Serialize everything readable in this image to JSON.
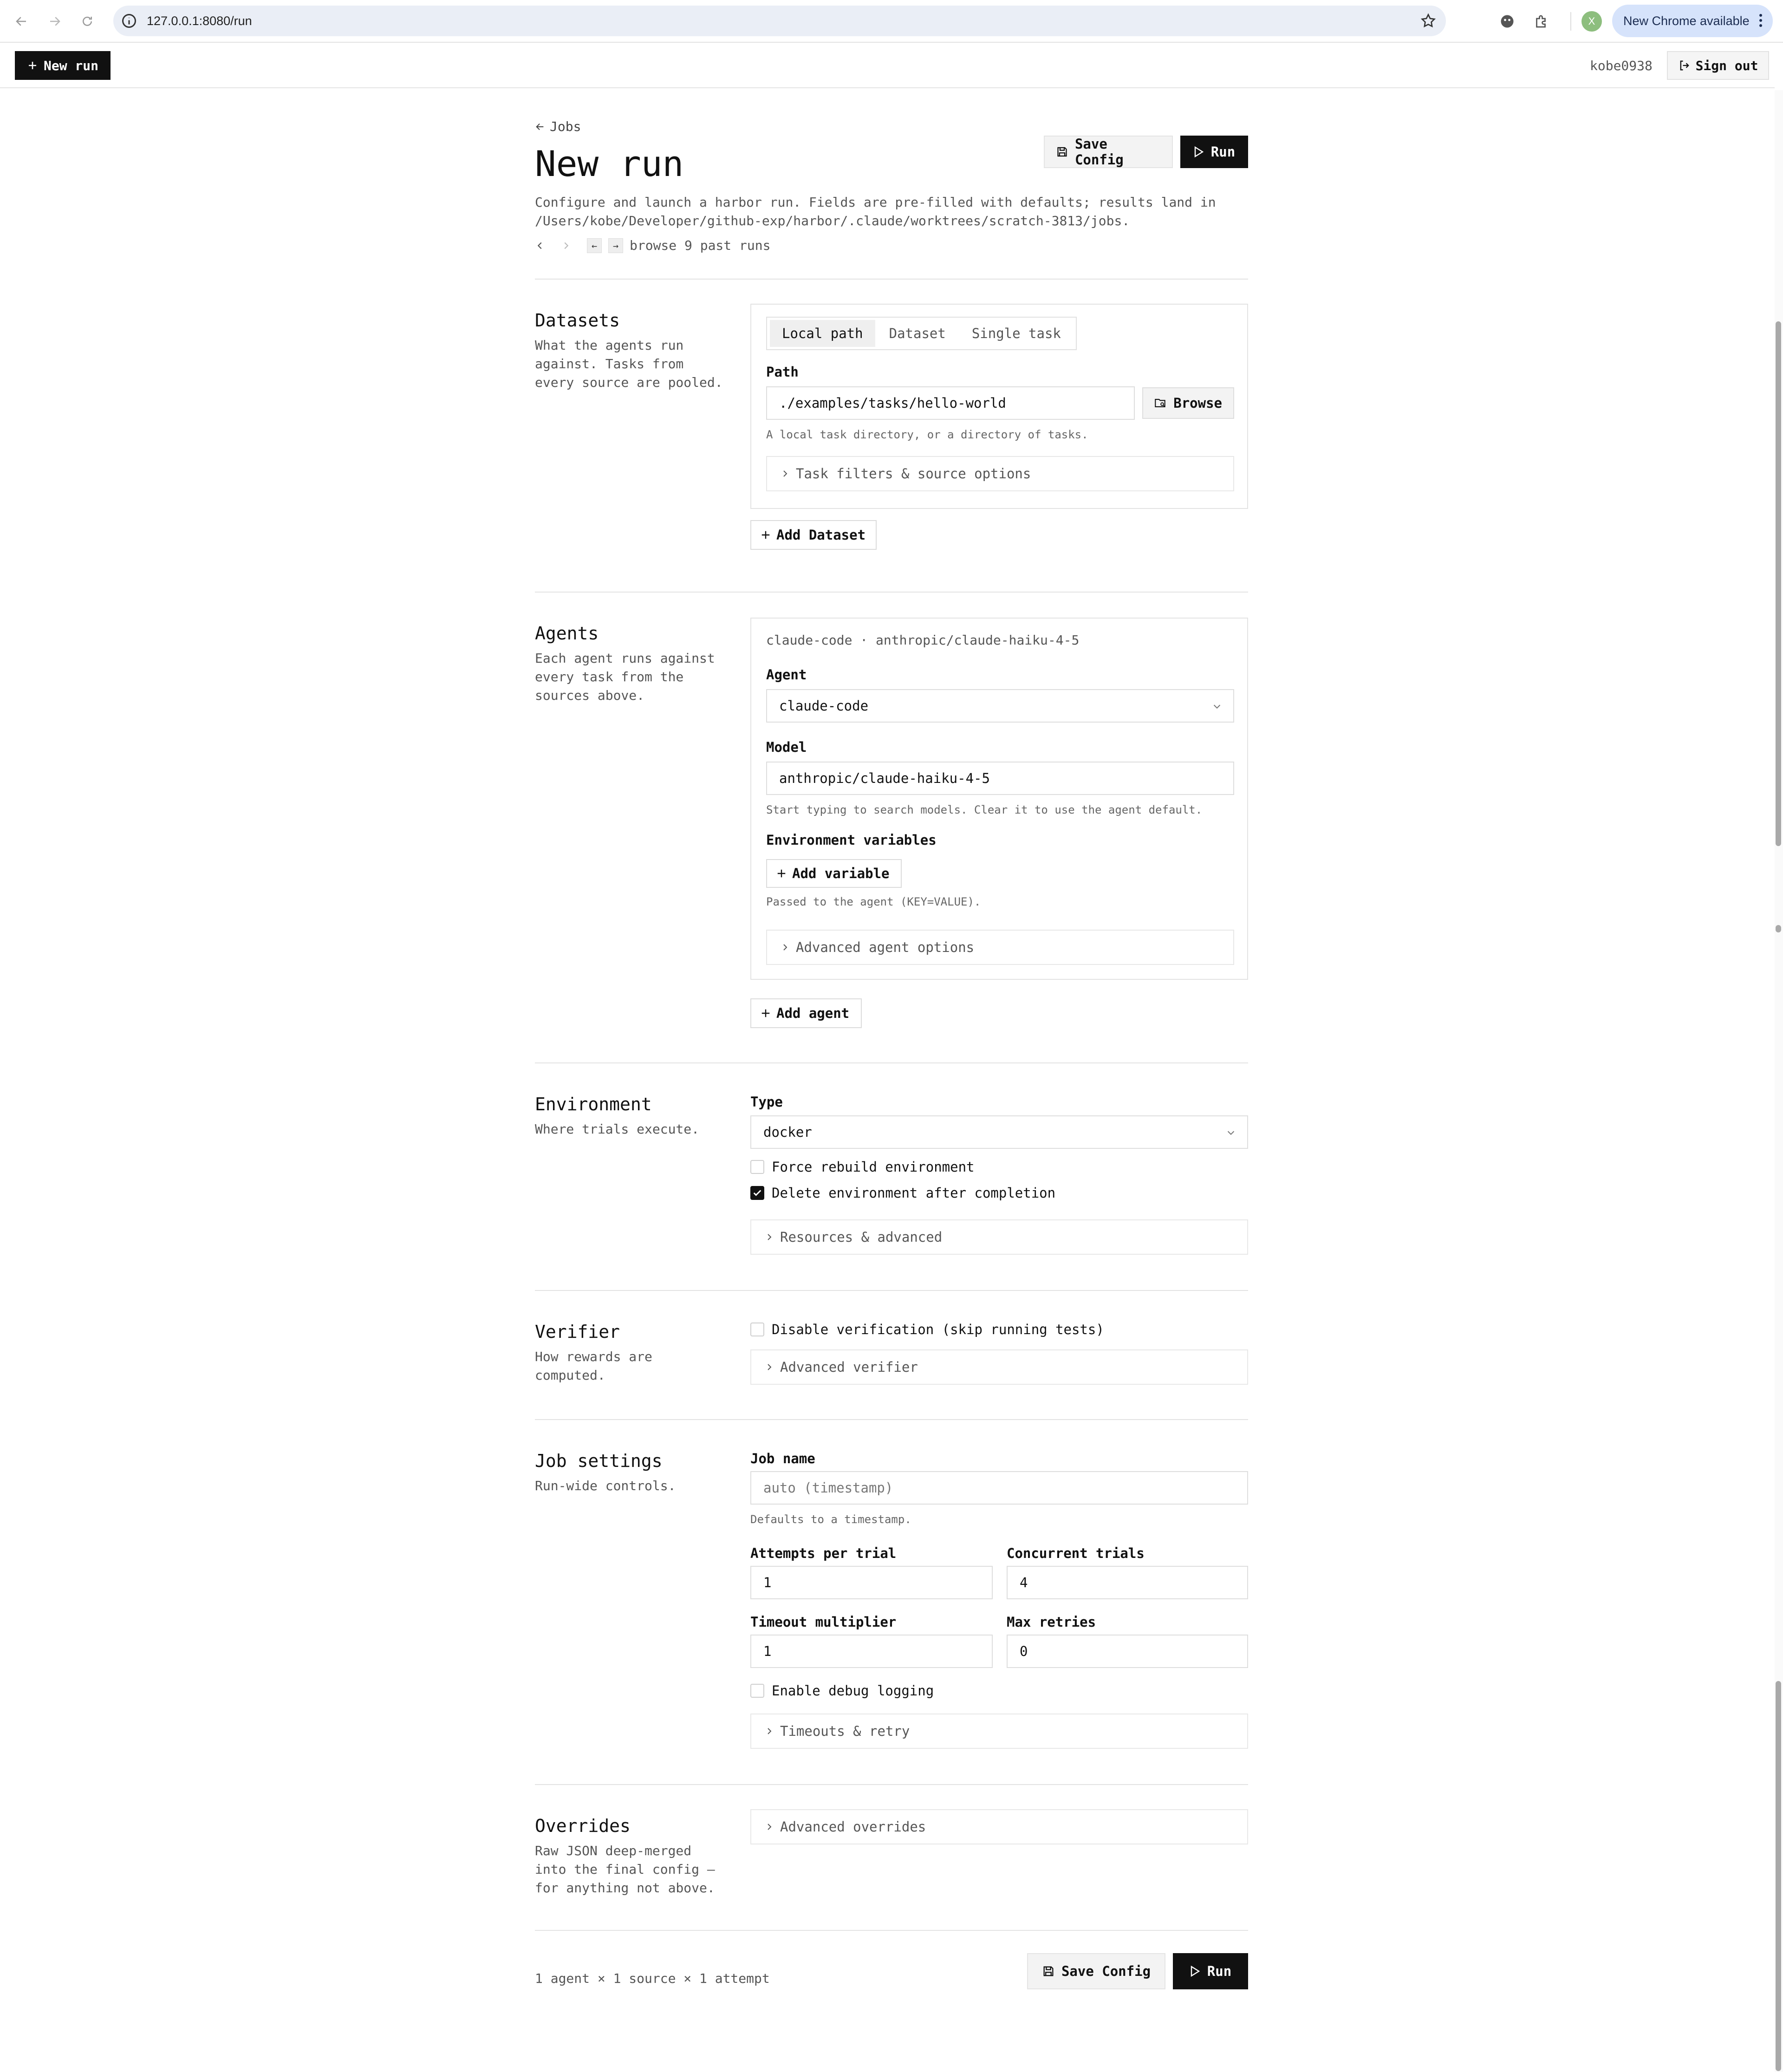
{
  "browser": {
    "url": "127.0.0.1:8080/run",
    "profile_initial": "X",
    "update_label": "New Chrome available"
  },
  "appbar": {
    "new_run_label": "New run",
    "username": "kobe0938",
    "sign_out_label": "Sign out"
  },
  "header": {
    "back_label": "Jobs",
    "title": "New run",
    "save_config_label": "Save Config",
    "run_label": "Run",
    "description_line1": "Configure and launch a harbor run. Fields are pre-filled with defaults; results land in",
    "description_line2": "/Users/kobe/Developer/github-exp/harbor/.claude/worktrees/scratch-3813/jobs.",
    "past_runs_label": "browse 9 past runs"
  },
  "datasets": {
    "title": "Datasets",
    "description": "What the agents run against. Tasks from every source are pooled.",
    "tabs": [
      "Local path",
      "Dataset",
      "Single task"
    ],
    "active_tab": "Local path",
    "path_label": "Path",
    "path_value": "./examples/tasks/hello-world",
    "browse_label": "Browse",
    "path_hint": "A local task directory, or a directory of tasks.",
    "filters_label": "Task filters & source options",
    "add_label": "Add Dataset"
  },
  "agents": {
    "title": "Agents",
    "description": "Each agent runs against every task from the sources above.",
    "card_summary": "claude-code · anthropic/claude-haiku-4-5",
    "agent_label": "Agent",
    "agent_value": "claude-code",
    "model_label": "Model",
    "model_value": "anthropic/claude-haiku-4-5",
    "model_hint": "Start typing to search models. Clear it to use the agent default.",
    "env_label": "Environment variables",
    "add_variable_label": "Add variable",
    "env_hint": "Passed to the agent (KEY=VALUE).",
    "advanced_label": "Advanced agent options",
    "add_agent_label": "Add agent"
  },
  "environment": {
    "title": "Environment",
    "description": "Where trials execute.",
    "type_label": "Type",
    "type_value": "docker",
    "force_rebuild_label": "Force rebuild environment",
    "force_rebuild_checked": false,
    "delete_after_label": "Delete environment after completion",
    "delete_after_checked": true,
    "resources_label": "Resources & advanced"
  },
  "verifier": {
    "title": "Verifier",
    "description": "How rewards are computed.",
    "disable_label": "Disable verification (skip running tests)",
    "disable_checked": false,
    "advanced_label": "Advanced verifier"
  },
  "job_settings": {
    "title": "Job settings",
    "description": "Run-wide controls.",
    "job_name_label": "Job name",
    "job_name_placeholder": "auto (timestamp)",
    "job_name_hint": "Defaults to a timestamp.",
    "attempts_label": "Attempts per trial",
    "attempts_value": "1",
    "concurrent_label": "Concurrent trials",
    "concurrent_value": "4",
    "timeout_label": "Timeout multiplier",
    "timeout_value": "1",
    "retries_label": "Max retries",
    "retries_value": "0",
    "debug_label": "Enable debug logging",
    "debug_checked": false,
    "timeouts_label": "Timeouts & retry"
  },
  "overrides": {
    "title": "Overrides",
    "description": "Raw JSON deep-merged into the final config — for anything not above.",
    "advanced_label": "Advanced overrides"
  },
  "footer": {
    "summary": "1 agent × 1 source × 1 attempt",
    "save_config_label": "Save Config",
    "run_label": "Run"
  }
}
